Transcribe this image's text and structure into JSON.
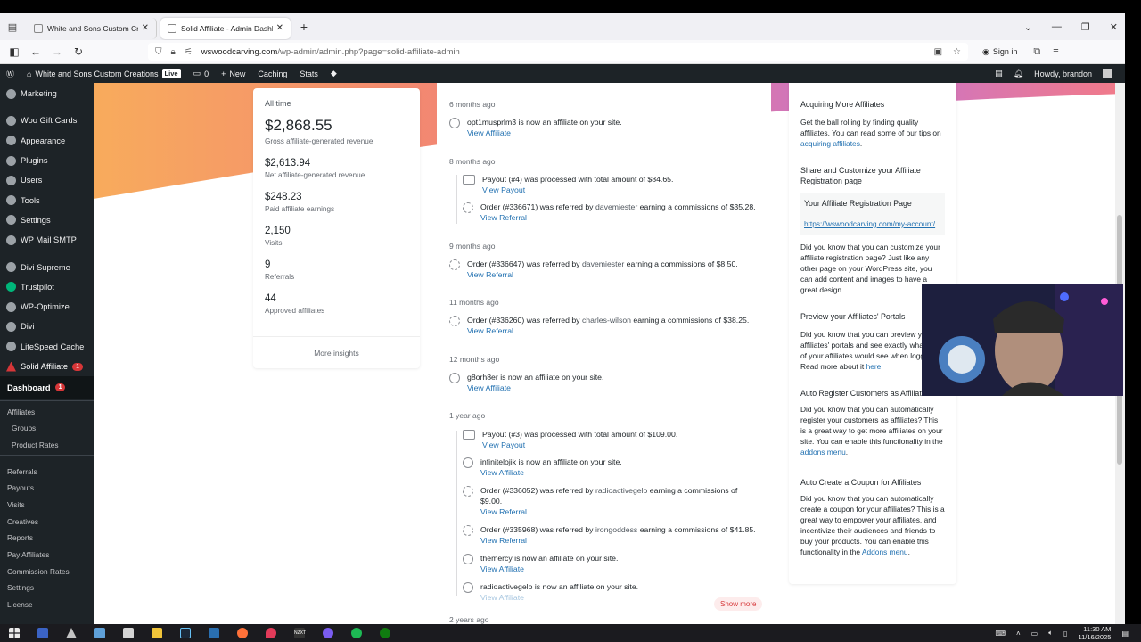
{
  "browser": {
    "tabs": [
      {
        "label": "White and Sons Custom Creations",
        "active": false
      },
      {
        "label": "Solid Affiliate - Admin Dashboard",
        "active": true
      }
    ],
    "url_host": "wswoodcarving.com",
    "url_path": "/wp-admin/admin.php?page=solid-affiliate-admin",
    "signin_label": "Sign in"
  },
  "adminbar": {
    "site_name": "White and Sons Custom Creations",
    "live_badge": "Live",
    "comments_count": "0",
    "new_label": "New",
    "caching_label": "Caching",
    "stats_label": "Stats",
    "howdy": "Howdy, brandon"
  },
  "sidebar": {
    "items": [
      {
        "label": "Marketing",
        "icon": "megaphone-icon"
      },
      {
        "label": "Woo Gift Cards",
        "icon": "gift-icon"
      },
      {
        "label": "Appearance",
        "icon": "brush-icon"
      },
      {
        "label": "Plugins",
        "icon": "plugin-icon"
      },
      {
        "label": "Users",
        "icon": "users-icon"
      },
      {
        "label": "Tools",
        "icon": "wrench-icon"
      },
      {
        "label": "Settings",
        "icon": "settings-icon"
      },
      {
        "label": "WP Mail SMTP",
        "icon": "mail-icon"
      },
      {
        "label": "Divi Supreme",
        "icon": "divi-supreme-icon"
      },
      {
        "label": "Trustpilot",
        "icon": "star-icon"
      },
      {
        "label": "WP-Optimize",
        "icon": "optimize-icon"
      },
      {
        "label": "Divi",
        "icon": "divi-icon"
      },
      {
        "label": "LiteSpeed Cache",
        "icon": "litespeed-icon"
      }
    ],
    "solid_affiliate": {
      "label": "Solid Affiliate",
      "count": "1"
    },
    "dashboard": {
      "label": "Dashboard",
      "count": "1"
    },
    "sub_group1": [
      "Affiliates",
      "Groups",
      "Product Rates"
    ],
    "sub_group2": [
      "Referrals",
      "Payouts",
      "Visits",
      "Creatives",
      "Reports",
      "Pay Affiliates",
      "Commission Rates",
      "Settings",
      "License"
    ]
  },
  "stats": {
    "period": "All time",
    "gross_value": "$2,868.55",
    "gross_label": "Gross affiliate-generated revenue",
    "net_value": "$2,613.94",
    "net_label": "Net affiliate-generated revenue",
    "paid_value": "$248.23",
    "paid_label": "Paid affiliate earnings",
    "visits_value": "2,150",
    "visits_label": "Visits",
    "referrals_value": "9",
    "referrals_label": "Referrals",
    "approved_value": "44",
    "approved_label": "Approved affiliates",
    "more_insights": "More insights"
  },
  "activity": {
    "groups": [
      "6 months ago",
      "8 months ago",
      "9 months ago",
      "11 months ago",
      "12 months ago",
      "1 year ago",
      "2 years ago"
    ],
    "items": [
      {
        "type": "affiliate",
        "pre": "opt1musprlm3",
        "text": " is now an affiliate on your site.",
        "link": "View Affiliate"
      },
      {
        "type": "payout",
        "pre": "",
        "text": "Payout (#4) was processed with total amount of $84.65.",
        "link": "View Payout"
      },
      {
        "type": "referral",
        "pre": "Order (#336671) was referred by ",
        "user": "davemiester",
        "text": " earning a commissions of $35.28.",
        "link": "View Referral"
      },
      {
        "type": "referral",
        "pre": "Order (#336647) was referred by ",
        "user": "davemiester",
        "text": " earning a commissions of $8.50.",
        "link": "View Referral"
      },
      {
        "type": "referral",
        "pre": "Order (#336260) was referred by ",
        "user": "charles-wilson",
        "text": " earning a commissions of $38.25.",
        "link": "View Referral"
      },
      {
        "type": "affiliate",
        "pre": "g8orh8er",
        "text": " is now an affiliate on your site.",
        "link": "View Affiliate"
      },
      {
        "type": "payout",
        "pre": "",
        "text": "Payout (#3) was processed with total amount of $109.00.",
        "link": "View Payout"
      },
      {
        "type": "affiliate",
        "pre": "infinitelojik",
        "text": " is now an affiliate on your site.",
        "link": "View Affiliate"
      },
      {
        "type": "referral",
        "pre": "Order (#336052) was referred by ",
        "user": "radioactivegelo",
        "text": " earning a commissions of $9.00.",
        "link": "View Referral"
      },
      {
        "type": "referral",
        "pre": "Order (#335968) was referred by ",
        "user": "irongoddess",
        "text": " earning a commissions of $41.85.",
        "link": "View Referral"
      },
      {
        "type": "affiliate",
        "pre": "themercy",
        "text": " is now an affiliate on your site.",
        "link": "View Affiliate"
      },
      {
        "type": "affiliate",
        "pre": "radioactivegelo",
        "text": " is now an affiliate on your site.",
        "link": "View Affiliate"
      }
    ],
    "show_more": "Show more"
  },
  "tips": {
    "acquire_title": "Acquiring More Affiliates",
    "acquire_text": "Get the ball rolling by finding quality affiliates. You can read some of our tips on ",
    "acquire_link": "acquiring affiliates",
    "share_title": "Share and Customize your Affiliate Registration page",
    "reg_box_title": "Your Affiliate Registration Page",
    "reg_url": "https://wswoodcarving.com/my-account/",
    "customize_text": "Did you know that you can customize your affiliate registration page? Just like any other page on your WordPress site, you can add content and images to have a great design.",
    "preview_title": "Preview your Affiliates' Portals",
    "preview_text": "Did you know that you can preview your affiliates' portals and see exactly what any of your affiliates would see when logged in? Read more about it ",
    "preview_link": "here",
    "auto_reg_title": "Auto Register Customers as Affiliates",
    "auto_reg_text": "Did you know that you can automatically register your customers as affiliates? This is a great way to get more affiliates on your site. You can enable this functionality in the ",
    "auto_reg_link": "addons menu",
    "coupon_title": "Auto Create a Coupon for Affiliates",
    "coupon_text": "Did you know that you can automatically create a coupon for your affiliates? This is a great way to empower your affiliates, and incentivize their audiences and friends to buy your products. You can enable this functionality in the ",
    "coupon_link": "Addons menu"
  },
  "taskbar": {
    "time": "11:30 AM",
    "date": "11/16/2025"
  },
  "colors": {
    "accent": "#2271b1",
    "wp_dark": "#1d2327",
    "badge": "#d63638"
  }
}
